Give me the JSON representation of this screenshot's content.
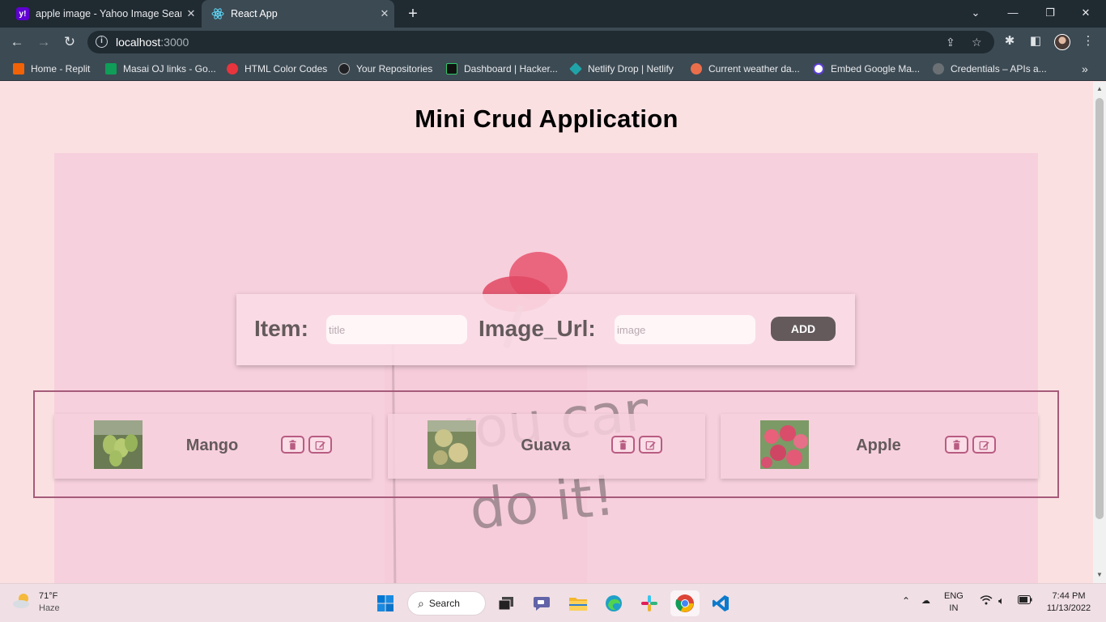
{
  "browser": {
    "tabs": [
      {
        "title": "apple image - Yahoo Image Search",
        "active": false
      },
      {
        "title": "React App",
        "active": true
      }
    ],
    "address": {
      "host": "localhost",
      "port": ":3000"
    },
    "bookmarks": [
      {
        "label": "Home - Replit",
        "color": "#f26207"
      },
      {
        "label": "Masai OJ links - Go...",
        "color": "#0f9d58"
      },
      {
        "label": "HTML Color Codes",
        "color": "#e8343d"
      },
      {
        "label": "Your Repositories",
        "color": "#202124"
      },
      {
        "label": "Dashboard | Hacker...",
        "color": "#111111"
      },
      {
        "label": "Netlify Drop | Netlify",
        "color": "#20a3a8"
      },
      {
        "label": "Current weather da...",
        "color": "#eb6e4b"
      },
      {
        "label": "Embed Google Ma...",
        "color": "#5b3fd6"
      },
      {
        "label": "Credentials – APIs a...",
        "color": "#6b7075"
      }
    ]
  },
  "app": {
    "title": "Mini Crud Application",
    "form": {
      "item_label": "Item:",
      "item_placeholder": "title",
      "image_label": "Image_Url:",
      "image_placeholder": "image",
      "add_label": "ADD"
    },
    "items": [
      {
        "name": "Mango",
        "image": "mango"
      },
      {
        "name": "Guava",
        "image": "guava"
      },
      {
        "name": "Apple",
        "image": "apple"
      }
    ],
    "poster_text": [
      "you can",
      "do it!"
    ]
  },
  "taskbar": {
    "weather": {
      "temp": "71°F",
      "condition": "Haze"
    },
    "search_label": "Search",
    "language": {
      "line1": "ENG",
      "line2": "IN"
    },
    "clock": {
      "time": "7:44 PM",
      "date": "11/13/2022"
    }
  }
}
